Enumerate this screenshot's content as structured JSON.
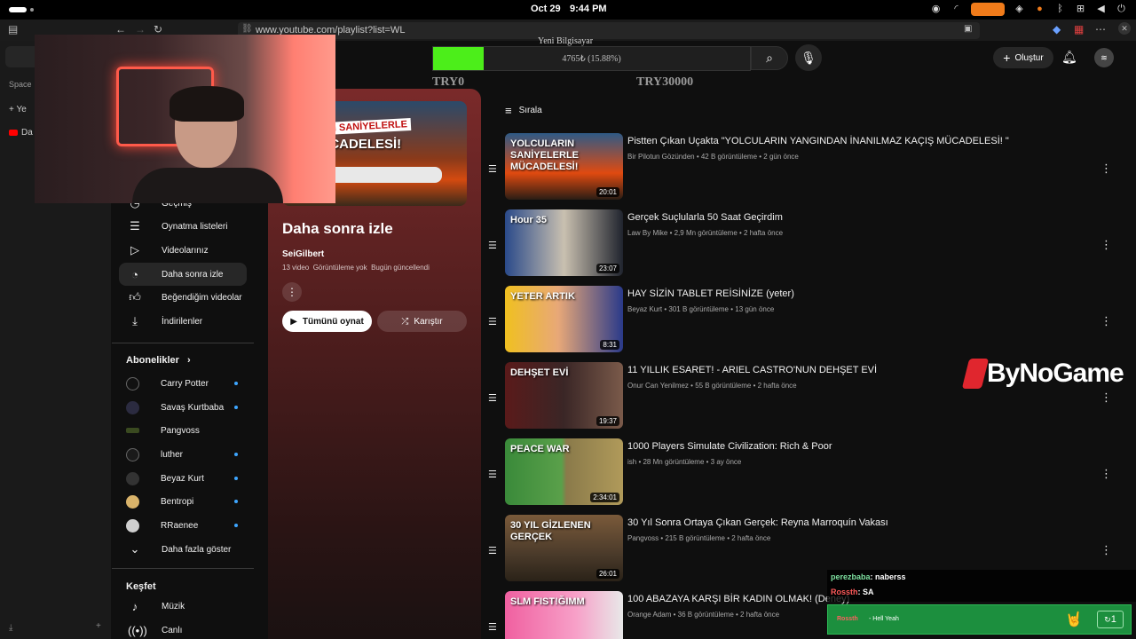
{
  "os": {
    "date": "Oct 29",
    "time": "9:44 PM"
  },
  "browser": {
    "url_prefix": "www.youtube.com/",
    "url_path": "playlist?list=WL",
    "side_panel": {
      "space_label": "Space",
      "new_tab_label": "Ye",
      "tab_label": "Da"
    }
  },
  "donation": {
    "title": "Yeni Bilgisayar",
    "progress_text": "4765₺ (15.88%)",
    "progress_fraction": 0.1588,
    "min_label": "TRY0",
    "max_label": "TRY30000",
    "fill_color": "#4cee1a"
  },
  "topbar": {
    "create_label": "Oluştur"
  },
  "nav": {
    "items": [
      {
        "label": "Geçmiş",
        "icon": "history-icon"
      },
      {
        "label": "Oynatma listeleri",
        "icon": "playlists-icon"
      },
      {
        "label": "Videolarınız",
        "icon": "your-videos-icon"
      },
      {
        "label": "Daha sonra izle",
        "icon": "watch-later-icon"
      },
      {
        "label": "Beğendiğim videolar",
        "icon": "like-icon"
      },
      {
        "label": "İndirilenler",
        "icon": "download-icon"
      }
    ],
    "subscriptions_heading": "Abonelikler",
    "subscriptions": [
      {
        "name": "Carry Potter",
        "color": "#111111",
        "new": true
      },
      {
        "name": "Savaş Kurtbaba",
        "color": "#2b2b40",
        "new": true
      },
      {
        "name": "Pangvoss",
        "color": "#3a4a20",
        "new": false
      },
      {
        "name": "luther",
        "color": "#1a1a1a",
        "new": true
      },
      {
        "name": "Beyaz Kurt",
        "color": "#333333",
        "new": true
      },
      {
        "name": "Bentropi",
        "color": "#d9b36a",
        "new": true
      },
      {
        "name": "RRaenee",
        "color": "#cfcfcf",
        "new": true
      }
    ],
    "show_more": "Daha fazla göster",
    "explore_heading": "Keşfet",
    "explore": [
      {
        "label": "Müzik",
        "icon": "music-icon"
      },
      {
        "label": "Canlı",
        "icon": "live-icon"
      }
    ]
  },
  "playlist": {
    "thumb_text_1": "ARIN SANİYELERLE",
    "thumb_text_2": "MÜCADELESİ!",
    "title": "Daha sonra izle",
    "owner": "SeiGilbert",
    "meta_count": "13 video",
    "meta_views": "Görüntüleme yok",
    "meta_updated": "Bugün güncellendi",
    "play_all": "Tümünü oynat",
    "shuffle": "Karıştır"
  },
  "sort_label": "Sırala",
  "videos": [
    {
      "title": "Pistten Çıkan Uçakta \"YOLCULARIN YANGINDAN İNANILMAZ KAÇIŞ MÜCADELESİ! \"",
      "channel": "Bir Pilotun Gözünden",
      "views": "42 B görüntüleme",
      "age": "2 gün önce",
      "duration": "20:01",
      "thumb_bg": "linear-gradient(180deg,#2e5a86 0%,#e04a10 60%,#2a1d14 100%)",
      "thumb_text": "YOLCULARIN SANİYELERLE MÜCADELESİ!"
    },
    {
      "title": "Gerçek Suçlularla 50 Saat Geçirdim",
      "channel": "Law By Mike",
      "views": "2,9 Mn görüntüleme",
      "age": "2 hafta önce",
      "duration": "23:07",
      "thumb_bg": "linear-gradient(90deg,#2a4a8a 0%,#c9c0b0 50%,#20242e 100%)",
      "thumb_text": "Hour 35"
    },
    {
      "title": "HAY SİZİN TABLET REİSİNİZE (yeter)",
      "channel": "Beyaz Kurt",
      "views": "301 B görüntüleme",
      "age": "13 gün önce",
      "duration": "8:31",
      "thumb_bg": "linear-gradient(90deg,#f0c020 0%,#e8a878 45%,#2a3a8a 100%)",
      "thumb_text": "YETER ARTIK"
    },
    {
      "title": "11 YILLIK ESARET! - ARIEL CASTRO'NUN DEHŞET EVİ",
      "channel": "Onur Can Yenilmez",
      "views": "55 B görüntüleme",
      "age": "2 hafta önce",
      "duration": "19:37",
      "thumb_bg": "linear-gradient(90deg,#5a1a1a 0%,#3a2626 50%,#7a5a4a 100%)",
      "thumb_text": "DEHŞET EVİ"
    },
    {
      "title": "1000 Players Simulate Civilization: Rich & Poor",
      "channel": "ish",
      "views": "28 Mn görüntüleme",
      "age": "3 ay önce",
      "duration": "2:34:01",
      "thumb_bg": "linear-gradient(90deg,#3a8a3a 0%,#5aa04a 48%,#8a7a4a 52%,#b09a5a 100%)",
      "thumb_text": "PEACE   WAR"
    },
    {
      "title": "30 Yıl Sonra Ortaya Çıkan Gerçek: Reyna Marroquín Vakası",
      "channel": "Pangvoss",
      "views": "215 B görüntüleme",
      "age": "2 hafta önce",
      "duration": "26:01",
      "thumb_bg": "linear-gradient(180deg,#7a5a3a 0%,#4a3a2a 60%,#2a2218 100%)",
      "thumb_text": "30 YIL GİZLENEN GERÇEK"
    },
    {
      "title": "100 ABAZAYA KARŞI BİR KADIN OLMAK! (Deney)",
      "channel": "Orange Adam",
      "views": "36 B görüntüleme",
      "age": "2 hafta önce",
      "duration": "",
      "thumb_bg": "linear-gradient(90deg,#f060a0 0%,#f7a0c8 60%,#e8e8e8 100%)",
      "thumb_text": "SLM FIST!ĞIMM"
    }
  ],
  "overlay": {
    "brand": "ByNoGame",
    "chat": [
      {
        "user": "perezbaba",
        "text": ": naberss",
        "color": "#7ee0a0"
      },
      {
        "user": "Rossth",
        "text": ": SA",
        "color": "#ff5a5a"
      }
    ],
    "alert_user": "Rossth",
    "alert_text": "- Hell Yeah",
    "alert_count": "1"
  }
}
